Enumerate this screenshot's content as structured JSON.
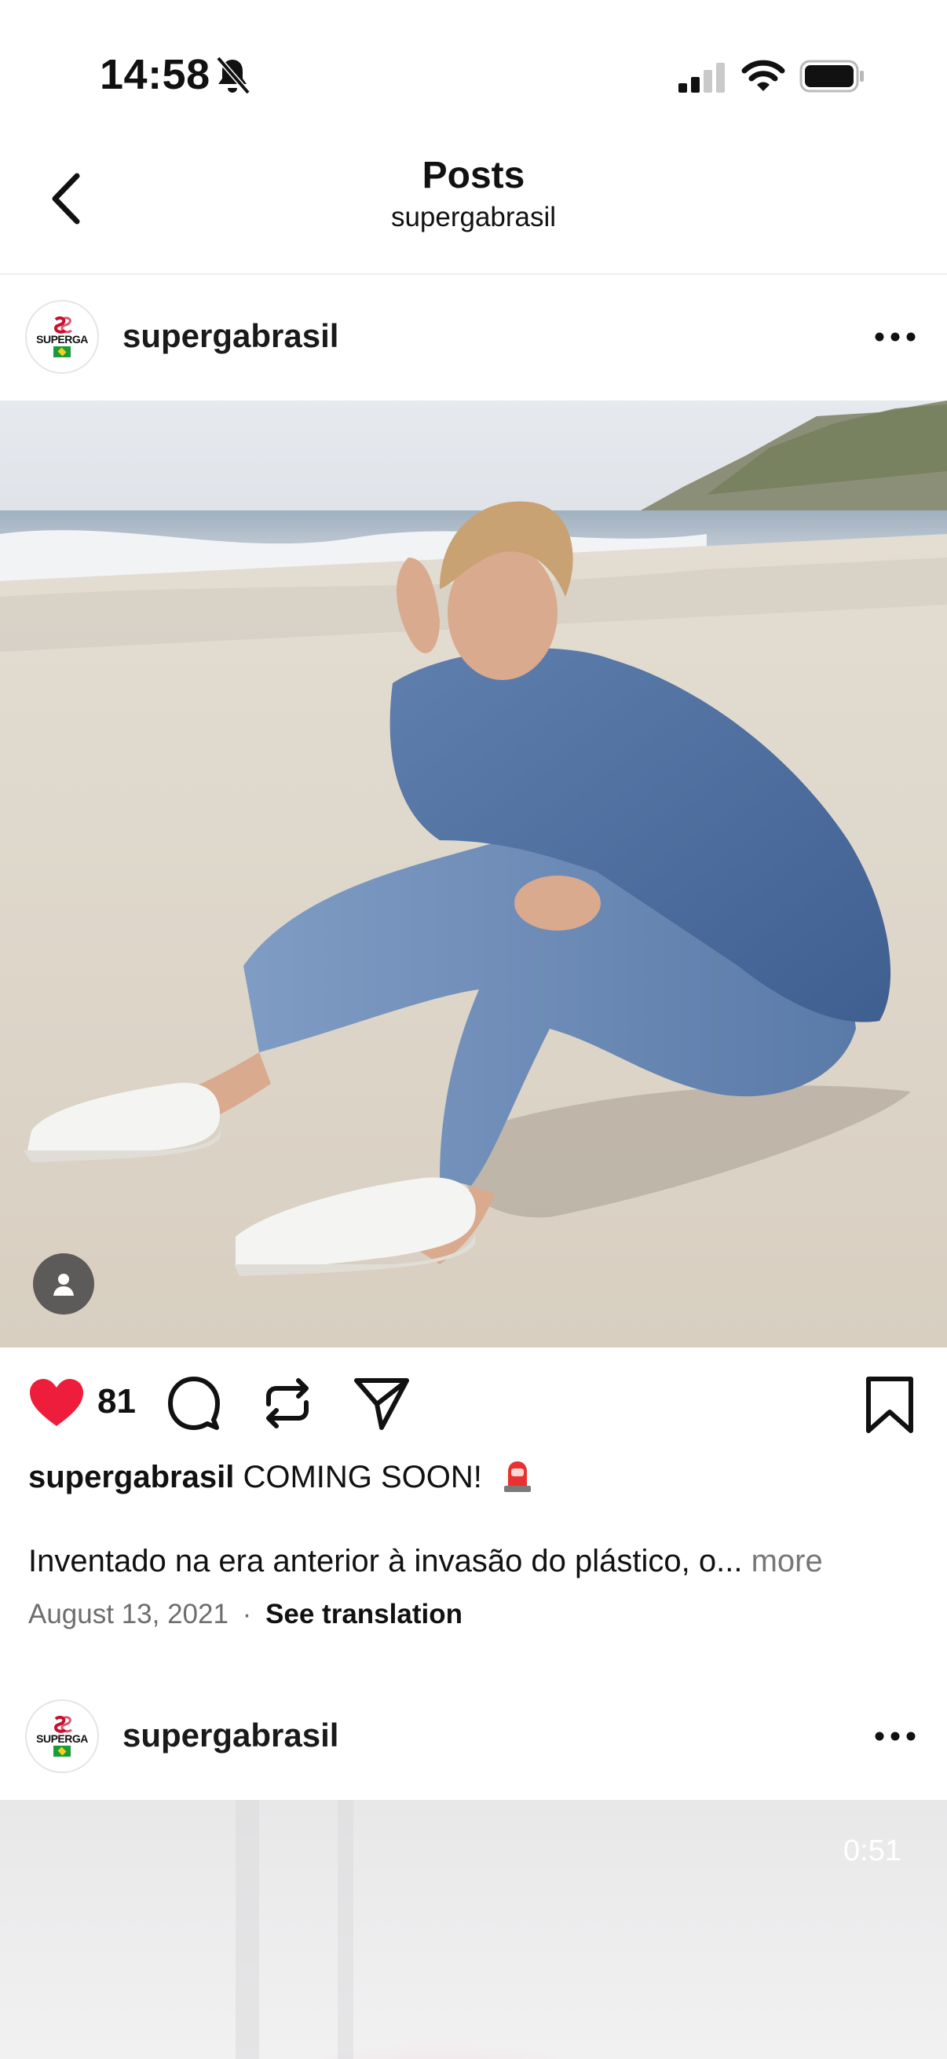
{
  "status_bar": {
    "time": "14:58"
  },
  "nav": {
    "title": "Posts",
    "subtitle": "supergabrasil"
  },
  "post1": {
    "avatar_brand": "SUPERGA",
    "username": "supergabrasil",
    "likes": "81",
    "caption_user": "supergabrasil",
    "caption_title": "COMING SOON!",
    "caption_text": "Inventado na era anterior à invasão do plástico, o...",
    "more_label": "more",
    "date": "August 13, 2021",
    "separator": "·",
    "translation_label": "See translation"
  },
  "post2": {
    "avatar_brand": "SUPERGA",
    "username": "supergabrasil",
    "video_duration": "0:51"
  },
  "colors": {
    "like": "#ee1d3c",
    "muted": "#6e6e6e",
    "divider": "#ececec"
  }
}
